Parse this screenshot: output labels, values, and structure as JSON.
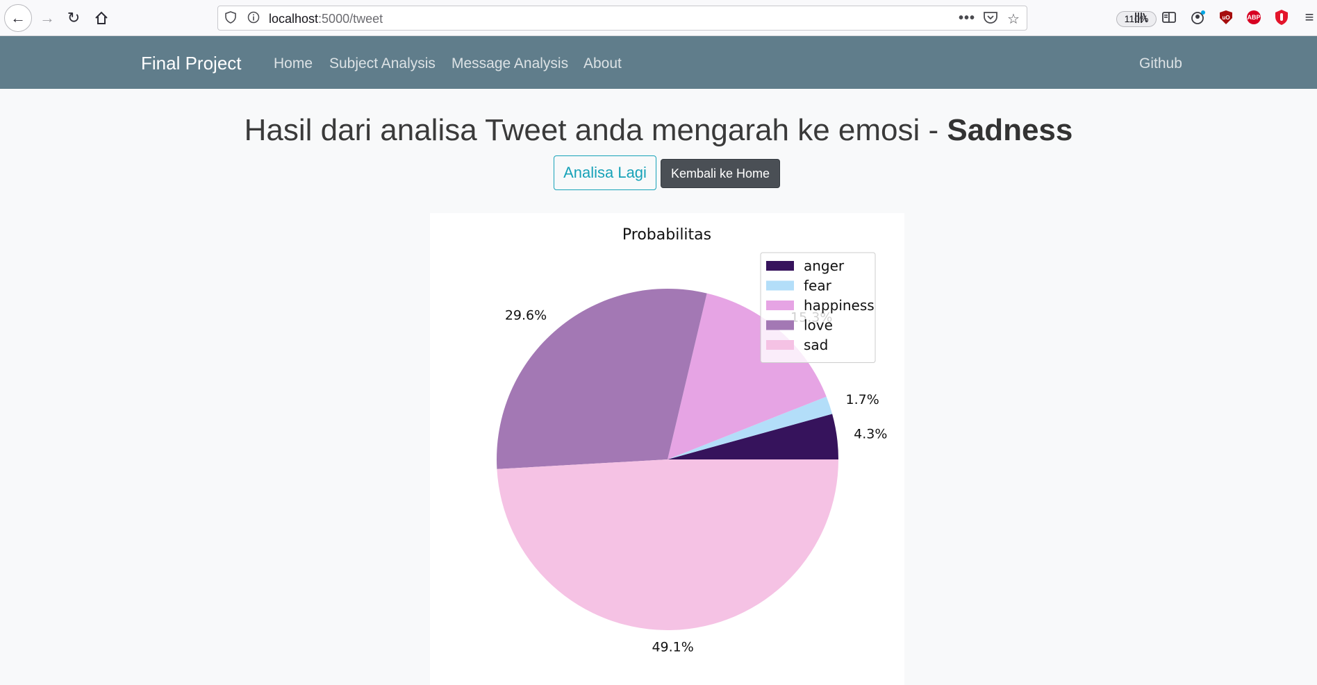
{
  "browser": {
    "url_host": "localhost",
    "url_path": ":5000/tweet",
    "zoom": "110%",
    "icons": [
      "back-arrow-icon",
      "forward-arrow-icon",
      "reload-icon",
      "home-icon",
      "shield-icon",
      "info-icon",
      "more-icon",
      "pocket-icon",
      "star-icon",
      "library-icon",
      "sidebar-icon",
      "account-icon",
      "ublock-icon",
      "abp-icon",
      "opera-shield-icon",
      "menu-icon"
    ]
  },
  "navbar": {
    "brand": "Final Project",
    "links": [
      "Home",
      "Subject Analysis",
      "Message Analysis",
      "About"
    ],
    "right_link": "Github",
    "background": "#607d8b"
  },
  "main": {
    "headline_prefix": "Hasil dari analisa Tweet anda mengarah ke emosi - ",
    "headline_emotion": "Sadness",
    "analyze_again_button": "Analisa Lagi",
    "back_home_button": "Kembali ke Home",
    "accent_color": "#17a2b8"
  },
  "chart_data": {
    "type": "pie",
    "title": "Probabilitas",
    "categories": [
      "anger",
      "fear",
      "happiness",
      "love",
      "sad"
    ],
    "values": [
      4.3,
      1.7,
      15.3,
      29.6,
      49.1
    ],
    "labels": [
      "4.3%",
      "1.7%",
      "15.3%",
      "29.6%",
      "49.1%"
    ],
    "colors": [
      "#36135c",
      "#b3def9",
      "#e6a4e4",
      "#a378b4",
      "#f5c2e4"
    ],
    "legend": "top-right"
  }
}
